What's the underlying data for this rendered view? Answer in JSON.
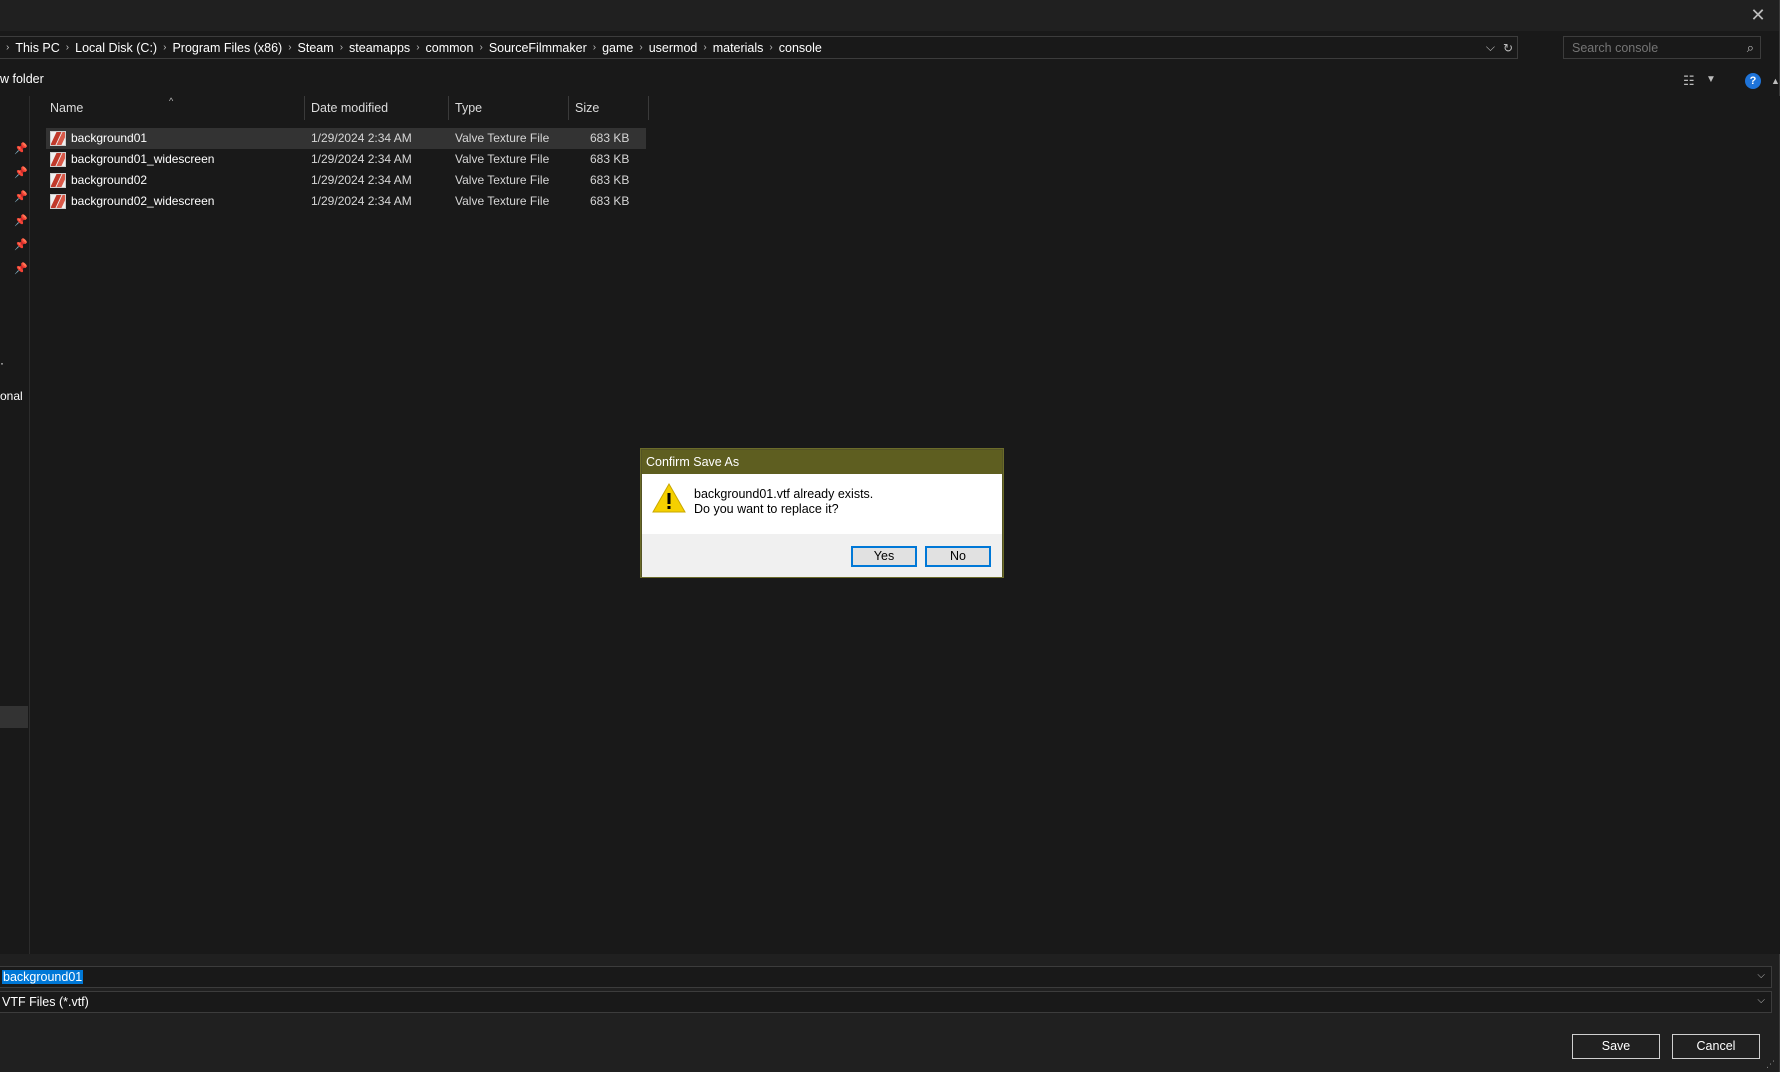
{
  "breadcrumb": [
    "This PC",
    "Local Disk (C:)",
    "Program Files (x86)",
    "Steam",
    "steamapps",
    "common",
    "SourceFilmmaker",
    "game",
    "usermod",
    "materials",
    "console"
  ],
  "search": {
    "placeholder": "Search console"
  },
  "toolbar": {
    "new_folder_label": "w folder"
  },
  "nav": {
    "fragment_1": "onal",
    "fragment_2": "·"
  },
  "columns": {
    "name": "Name",
    "date": "Date modified",
    "type": "Type",
    "size": "Size"
  },
  "files": [
    {
      "name": "background01",
      "date": "1/29/2024 2:34 AM",
      "type": "Valve Texture File",
      "size": "683 KB"
    },
    {
      "name": "background01_widescreen",
      "date": "1/29/2024 2:34 AM",
      "type": "Valve Texture File",
      "size": "683 KB"
    },
    {
      "name": "background02",
      "date": "1/29/2024 2:34 AM",
      "type": "Valve Texture File",
      "size": "683 KB"
    },
    {
      "name": "background02_widescreen",
      "date": "1/29/2024 2:34 AM",
      "type": "Valve Texture File",
      "size": "683 KB"
    }
  ],
  "filename": {
    "value": "background01"
  },
  "filetype": {
    "value": "VTF Files (*.vtf)"
  },
  "buttons": {
    "save": "Save",
    "cancel": "Cancel"
  },
  "dialog": {
    "title": "Confirm Save As",
    "line1": "background01.vtf already exists.",
    "line2": "Do you want to replace it?",
    "yes": "Yes",
    "no": "No"
  },
  "colors": {
    "accent": "#0078d7",
    "dialog_title": "#5e5e20",
    "window_bg": "#191919"
  }
}
